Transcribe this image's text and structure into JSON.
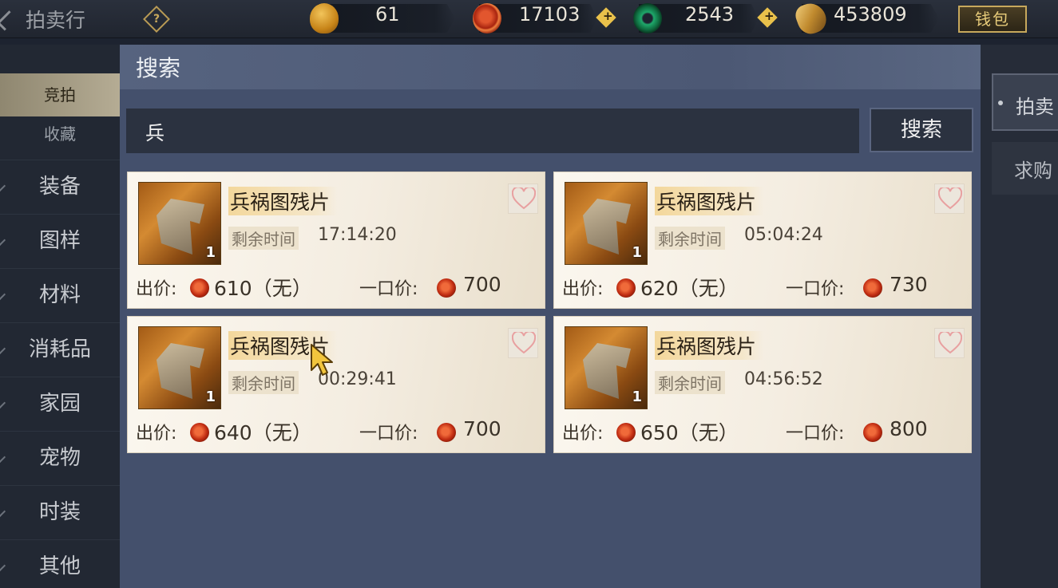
{
  "app_title": "拍卖行",
  "help_icon_glyph": "?",
  "currencies": [
    {
      "icon": "jade-pendant-icon",
      "value": "61"
    },
    {
      "icon": "copper-coin-icon",
      "value": "17103"
    },
    {
      "icon": "jade-ring-icon",
      "value": "2543"
    },
    {
      "icon": "gold-ingot-icon",
      "value": "453809"
    }
  ],
  "wallet_label": "钱包",
  "sidebar": {
    "tab_bid": "竞拍",
    "tab_fav": "收藏",
    "categories": [
      "装备",
      "图样",
      "材料",
      "消耗品",
      "家园",
      "宠物",
      "时装",
      "其他"
    ]
  },
  "right_tabs": [
    "拍卖",
    "求购"
  ],
  "search_panel": {
    "title": "搜索",
    "query": "兵",
    "button_label": "搜索"
  },
  "labels": {
    "time_remaining": "剩余时间",
    "bid": "出价:",
    "buyout": "一口价:"
  },
  "items": [
    {
      "name": "兵祸图残片",
      "qty": "1",
      "time": "17:14:20",
      "bid": "610（无）",
      "buyout": "700"
    },
    {
      "name": "兵祸图残片",
      "qty": "1",
      "time": "05:04:24",
      "bid": "620（无）",
      "buyout": "730"
    },
    {
      "name": "兵祸图残片",
      "qty": "1",
      "time": "00:29:41",
      "bid": "640（无）",
      "buyout": "700"
    },
    {
      "name": "兵祸图残片",
      "qty": "1",
      "time": "04:56:52",
      "bid": "650（无）",
      "buyout": "800"
    }
  ],
  "colors": {
    "panel": "#44506c",
    "card": "#f4ede1",
    "name_highlight": "#f3d79b",
    "accent_gold": "#c7a85c",
    "coin_red": "#c02c12"
  }
}
